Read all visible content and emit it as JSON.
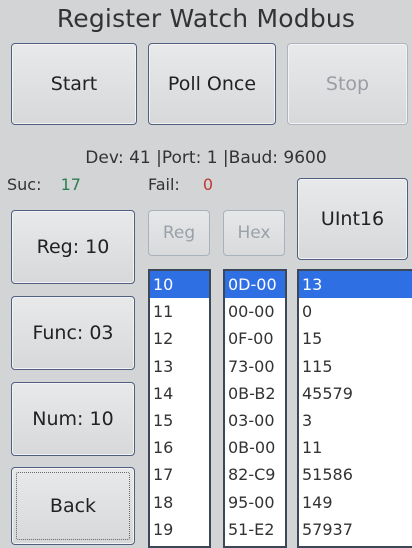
{
  "title": "Register Watch Modbus",
  "buttons": {
    "start": "Start",
    "poll_once": "Poll Once",
    "stop": "Stop",
    "reg": "Reg: 10",
    "func": "Func: 03",
    "num": "Num: 10",
    "back": "Back",
    "type": "UInt16"
  },
  "info": "Dev: 41 |Port: 1 |Baud: 9600",
  "stats": {
    "suc_label": "Suc:",
    "suc_value": "17",
    "fail_label": "Fail:",
    "fail_value": "0"
  },
  "headers": {
    "reg": "Reg",
    "hex": "Hex"
  },
  "rows": [
    {
      "reg": "10",
      "hex": "0D-00",
      "val": "13"
    },
    {
      "reg": "11",
      "hex": "00-00",
      "val": "0"
    },
    {
      "reg": "12",
      "hex": "0F-00",
      "val": "15"
    },
    {
      "reg": "13",
      "hex": "73-00",
      "val": "115"
    },
    {
      "reg": "14",
      "hex": "0B-B2",
      "val": "45579"
    },
    {
      "reg": "15",
      "hex": "03-00",
      "val": "3"
    },
    {
      "reg": "16",
      "hex": "0B-00",
      "val": "11"
    },
    {
      "reg": "17",
      "hex": "82-C9",
      "val": "51586"
    },
    {
      "reg": "18",
      "hex": "95-00",
      "val": "149"
    },
    {
      "reg": "19",
      "hex": "51-E2",
      "val": "57937"
    }
  ],
  "selected_row": 0,
  "colors": {
    "selection": "#2f6fe4",
    "success": "#2e7d4f",
    "fail": "#c0392b"
  }
}
